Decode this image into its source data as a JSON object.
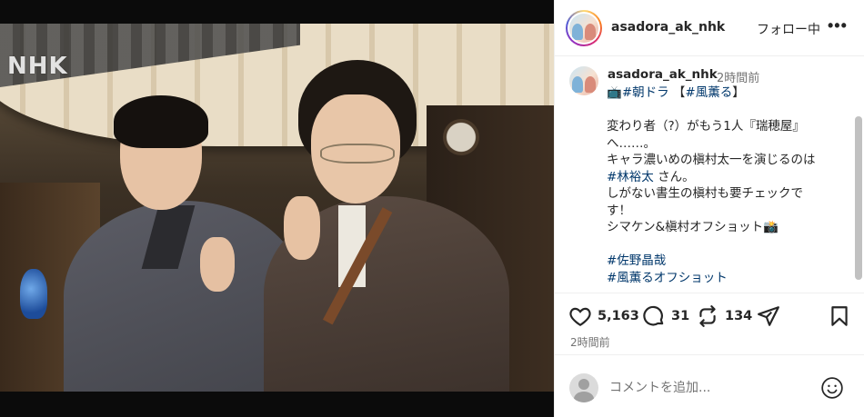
{
  "media": {
    "watermark": "NHK",
    "alt": "",
    "colors": {
      "letterbox": "#0b0b0b"
    }
  },
  "header": {
    "username": "asadora_ak_nhk",
    "follow_label": "フォロー中",
    "more_label": "•••"
  },
  "caption": {
    "username": "asadora_ak_nhk",
    "time": "2時間前",
    "lines": [
      [
        {
          "text": "📺"
        },
        {
          "text": "#朝ドラ",
          "tag": true
        },
        {
          "text": " 【"
        },
        {
          "text": "#風薫る",
          "tag": true
        },
        {
          "text": "】"
        }
      ],
      [
        {
          "text": ""
        }
      ],
      [
        {
          "text": "変わり者（?）がもう1人『瑞穂屋』"
        }
      ],
      [
        {
          "text": "へ……。"
        }
      ],
      [
        {
          "text": "キャラ濃いめの槇村太一を演じるのは"
        }
      ],
      [
        {
          "text": "#林裕太",
          "tag": true
        },
        {
          "text": " さん。"
        }
      ],
      [
        {
          "text": "しがない書生の槇村も要チェックで"
        }
      ],
      [
        {
          "text": "す！"
        }
      ],
      [
        {
          "text": "シマケン&槇村オフショット📸"
        }
      ],
      [
        {
          "text": ""
        }
      ],
      [
        {
          "text": "#佐野晶哉",
          "tag": true
        }
      ],
      [
        {
          "text": "#風薫るオフショット",
          "tag": true
        }
      ]
    ]
  },
  "actions": {
    "likes": "5,163",
    "comments": "31",
    "reposts": "134",
    "posted": "2時間前",
    "icons": [
      "heart-icon",
      "comment-icon",
      "repost-icon",
      "share-icon",
      "bookmark-icon"
    ]
  },
  "comment_box": {
    "placeholder": "コメントを追加...",
    "icon": "emoji-icon"
  },
  "colors": {
    "hashtag": "#00376b",
    "text": "#262626",
    "muted": "#737373",
    "divider": "#efefef"
  }
}
